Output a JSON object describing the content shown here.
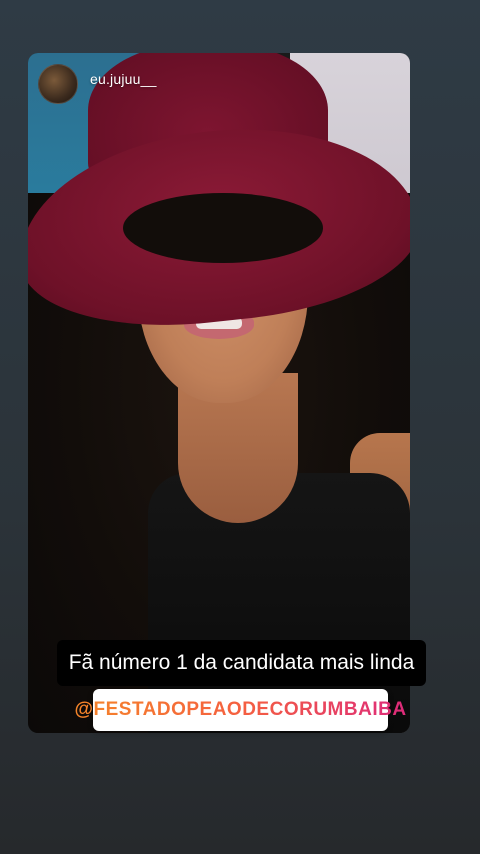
{
  "story": {
    "username": "eu.jujuu__",
    "caption": "Fã número 1 da candidata mais linda",
    "mention": "@FESTADOPEAODECORUMBAIBA"
  },
  "colors": {
    "hat": "#7a1430",
    "mention_gradient_start": "#f58529",
    "mention_gradient_end": "#dd2a7b",
    "caption_bg": "#000000"
  },
  "icons": {
    "avatar": "profile-avatar"
  }
}
